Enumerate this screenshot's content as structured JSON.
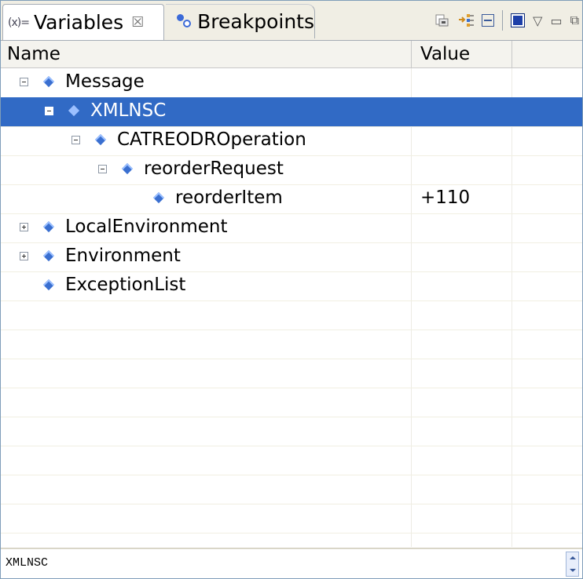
{
  "tabs": {
    "variables": {
      "label": "Variables",
      "icon_text": "(x)=",
      "close": "☒"
    },
    "breakpoints": {
      "label": "Breakpoints"
    }
  },
  "toolbar": {
    "icons": [
      "show-type-names-icon",
      "show-logical-structure-icon",
      "collapse-all-icon",
      "maximize-icon",
      "view-menu-icon",
      "minimize-icon",
      "restore-icon"
    ]
  },
  "columns": {
    "name": "Name",
    "value": "Value"
  },
  "tree": {
    "rows": [
      {
        "label": "Message",
        "value": "",
        "expander": "minus"
      },
      {
        "label": "XMLNSC",
        "value": "",
        "expander": "minus"
      },
      {
        "label": "CATREODROperation",
        "value": "",
        "expander": "minus"
      },
      {
        "label": "reorderRequest",
        "value": "",
        "expander": "minus"
      },
      {
        "label": "reorderItem",
        "value": "+110",
        "expander": "none"
      },
      {
        "label": "LocalEnvironment",
        "value": "",
        "expander": "plus"
      },
      {
        "label": "Environment",
        "value": "",
        "expander": "plus"
      },
      {
        "label": "ExceptionList",
        "value": "",
        "expander": "none"
      }
    ],
    "selected_label": "XMLNSC"
  },
  "detail": {
    "text": "XMLNSC"
  },
  "colors": {
    "selection": "#316ac5",
    "node_icon": "#3a6fd0"
  }
}
